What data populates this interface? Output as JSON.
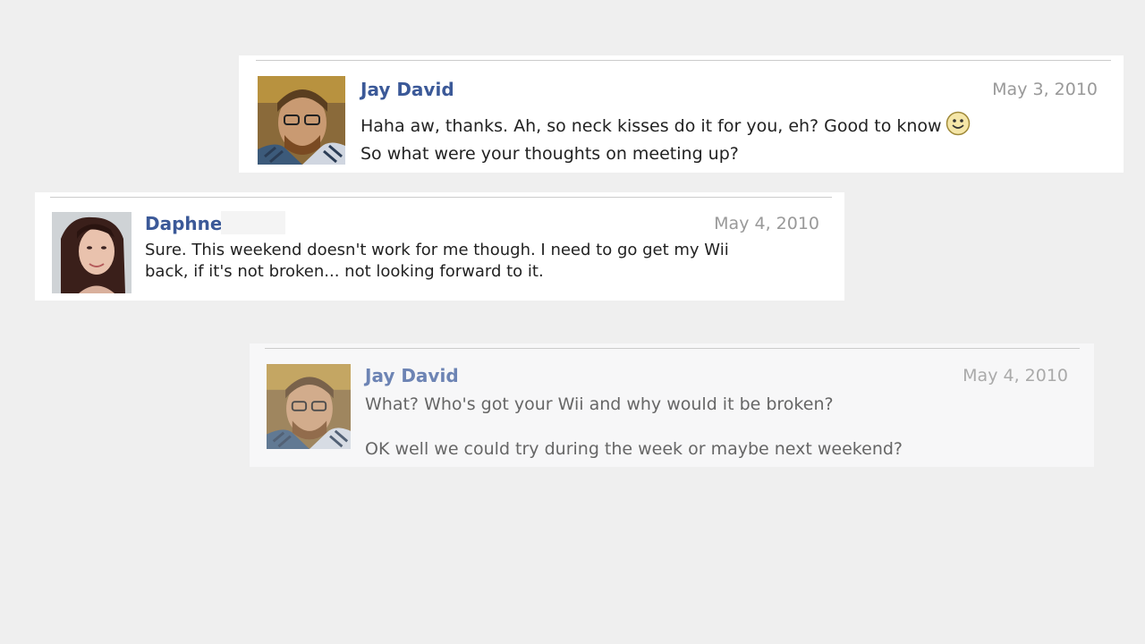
{
  "messages": [
    {
      "author": "Jay David",
      "date": "May 3, 2010",
      "lines": [
        "Haha aw, thanks. Ah, so neck kisses do it for you, eh? Good to know",
        "So what were your thoughts on meeting up?"
      ],
      "avatar_icon": "profile-photo-jay",
      "emoticon_icon": "smiley-icon"
    },
    {
      "author": "Daphne",
      "date": "May 4, 2010",
      "lines": [
        "Sure. This weekend doesn't work for me though. I need to go get my Wii",
        "back, if it's not broken... not looking forward to it."
      ],
      "avatar_icon": "profile-photo-daphne"
    },
    {
      "author": "Jay David",
      "date": "May 4, 2010",
      "lines": [
        "What? Who's got your Wii and why would it be broken?",
        "OK well we could try during the week or maybe next weekend?"
      ],
      "avatar_icon": "profile-photo-jay"
    }
  ],
  "colors": {
    "background": "#efefef",
    "author_link": "#3b5998",
    "date": "#999999"
  }
}
